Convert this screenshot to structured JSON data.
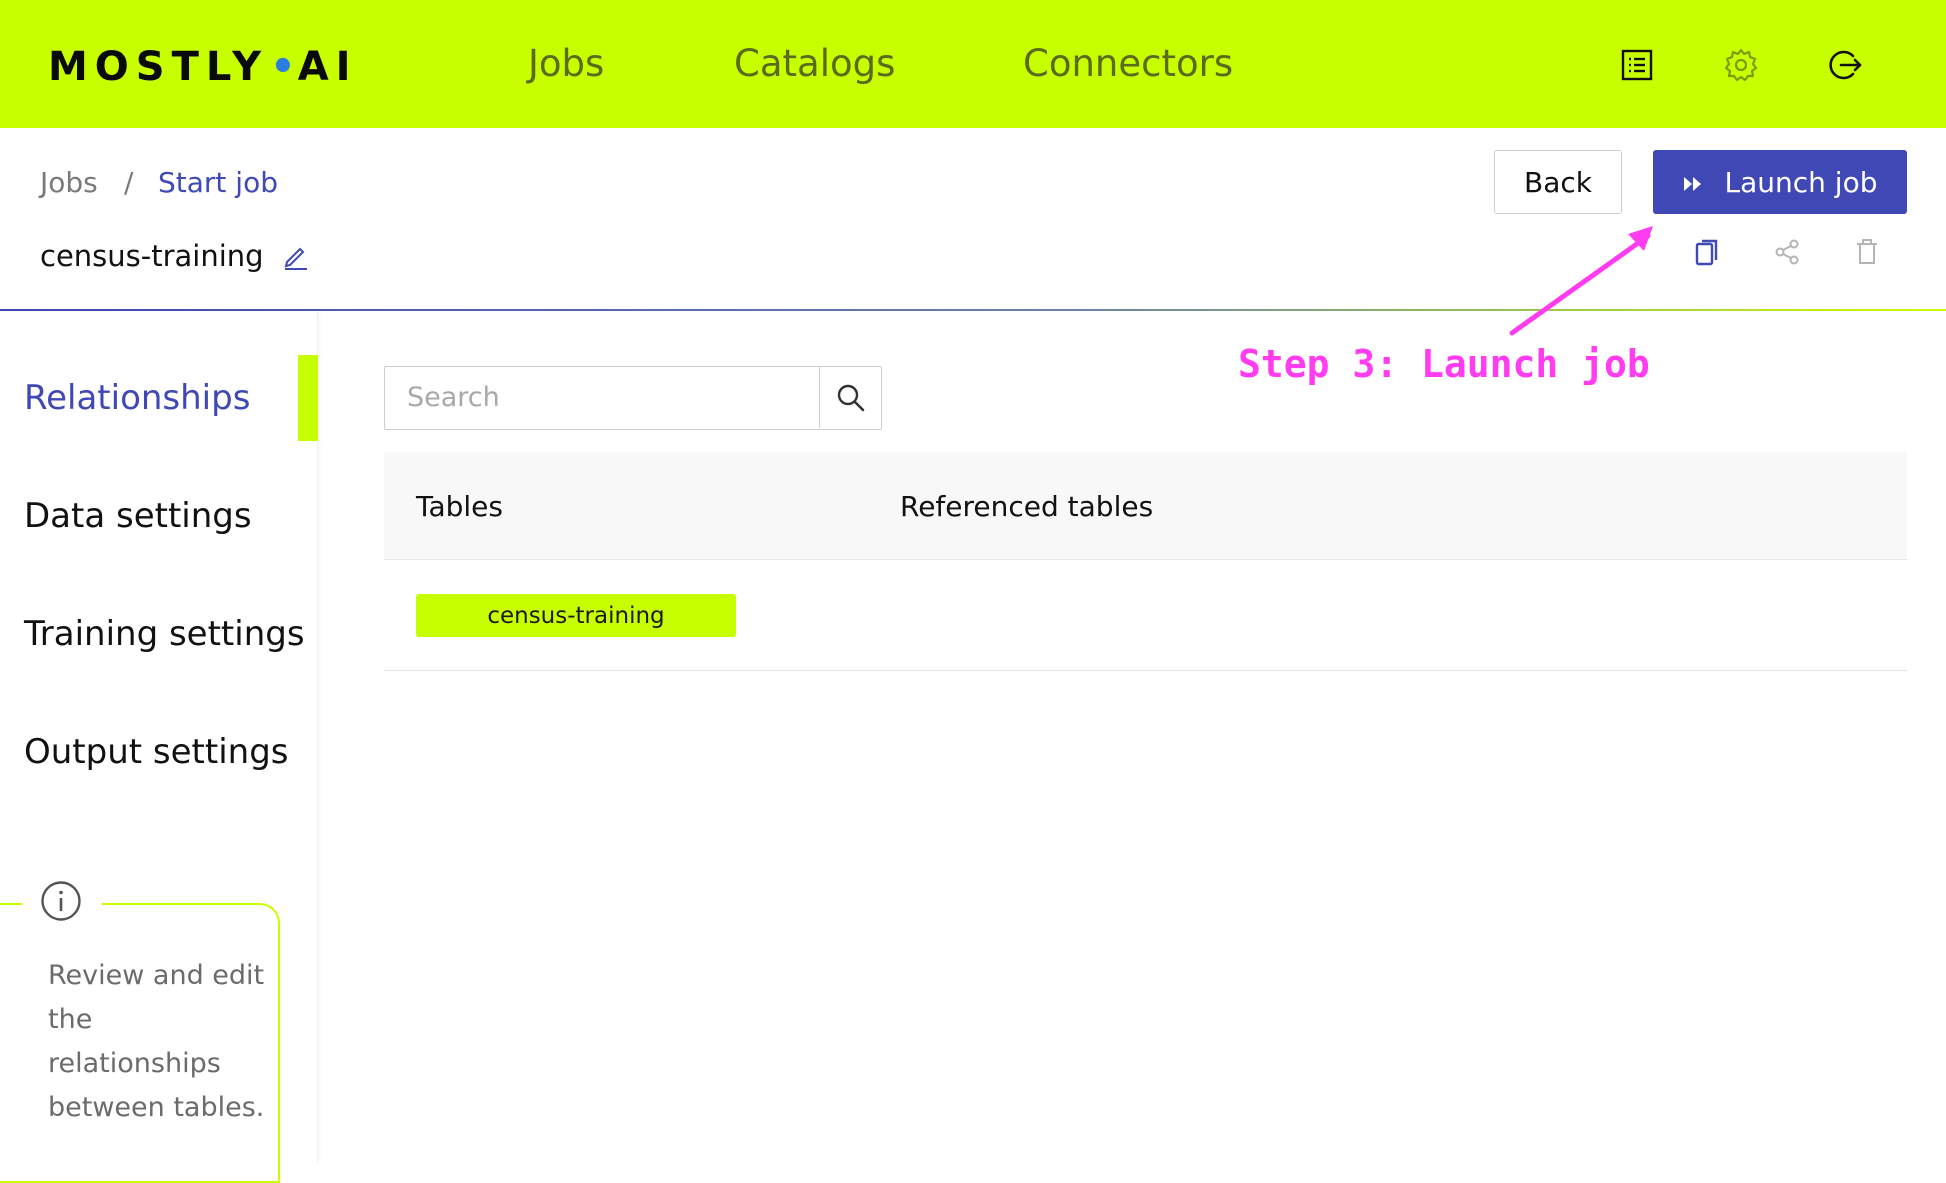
{
  "brand": {
    "logo_left": "MOSTLY",
    "logo_dot": "•",
    "logo_right": "AI"
  },
  "nav": {
    "jobs": "Jobs",
    "catalogs": "Catalogs",
    "connectors": "Connectors"
  },
  "breadcrumb": {
    "root": "Jobs",
    "separator": "/",
    "current": "Start job"
  },
  "job": {
    "name": "census-training"
  },
  "actions": {
    "back_label": "Back",
    "launch_label": "Launch job"
  },
  "sidebar": {
    "items": [
      {
        "label": "Relationships",
        "active": true
      },
      {
        "label": "Data settings",
        "active": false
      },
      {
        "label": "Training settings",
        "active": false
      },
      {
        "label": "Output settings",
        "active": false
      }
    ],
    "info_text": "Review and edit the relationships between tables."
  },
  "search": {
    "placeholder": "Search"
  },
  "table": {
    "headers": [
      "Tables",
      "Referenced tables"
    ],
    "rows": [
      {
        "table": "census-training",
        "referenced": ""
      }
    ]
  },
  "annotation": {
    "text": "Step 3: Launch job"
  },
  "colors": {
    "accent": "#c8ff00",
    "primary": "#3f48b5",
    "annotation": "#ff3cf0"
  }
}
